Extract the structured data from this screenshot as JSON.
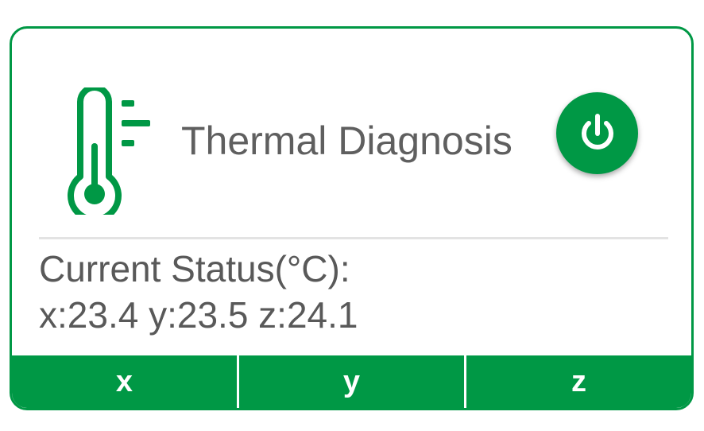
{
  "card": {
    "title": "Thermal Diagnosis",
    "icon": "thermometer-icon",
    "power_icon": "power-icon",
    "status_label": "Current Status(°C):",
    "status_values": "x:23.4 y:23.5 z:24.1"
  },
  "tabs": [
    {
      "label": "x"
    },
    {
      "label": "y"
    },
    {
      "label": "z"
    }
  ],
  "colors": {
    "accent": "#009845",
    "text": "#5f5f5f",
    "divider": "#e3e3e3"
  }
}
